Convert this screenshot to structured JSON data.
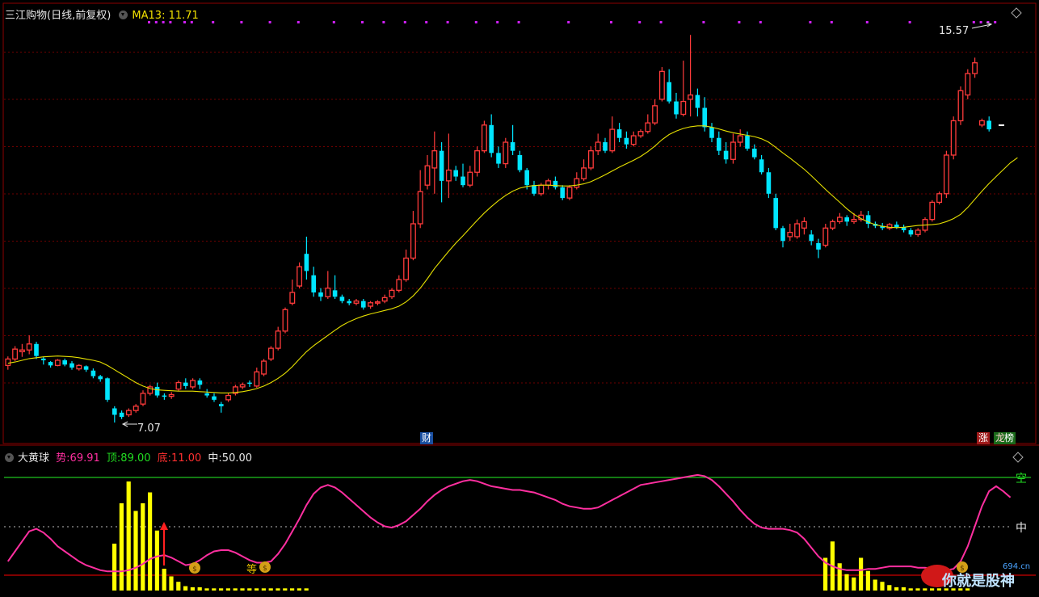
{
  "main_panel": {
    "stock_title": "三江购物(日线,前复权)",
    "ma_label": "MA13:",
    "ma_value": "11.71",
    "high_label": "15.57",
    "low_label": "7.07",
    "badge_cai": "财",
    "badge_zhang": "涨",
    "badge_long": "龙",
    "badge_bang": "榜"
  },
  "sub_panel": {
    "indicator_name": "大黄球",
    "shi_label": "势:",
    "shi_value": "69.91",
    "ding_label": "顶:",
    "ding_value": "89.00",
    "di_label": "底:",
    "di_value": "11.00",
    "zhong_label": "中:",
    "zhong_value": "50.00",
    "right_label_top": "空",
    "right_label_mid": "中",
    "deng_label": "等"
  },
  "watermark": {
    "text": "你就是股神",
    "site": "694.cn"
  },
  "colors": {
    "up": "#ff3b3b",
    "down": "#00e5ff",
    "ma": "#e6e000",
    "grid": "#8b0000",
    "indicator_line": "#ff2fa0",
    "bars": "#ffff00"
  },
  "chart_data": {
    "type": "candlestick",
    "price_range": [
      6.6,
      16.8
    ],
    "ma_period": 13,
    "candles": [
      [
        8.4,
        8.55,
        8.3,
        8.61
      ],
      [
        8.55,
        8.78,
        8.5,
        8.85
      ],
      [
        8.72,
        8.76,
        8.6,
        8.9
      ],
      [
        8.76,
        8.9,
        8.66,
        9.1
      ],
      [
        8.9,
        8.62,
        8.55,
        8.95
      ],
      [
        8.56,
        8.52,
        8.42,
        8.6
      ],
      [
        8.48,
        8.4,
        8.35,
        8.5
      ],
      [
        8.4,
        8.52,
        8.38,
        8.55
      ],
      [
        8.52,
        8.42,
        8.38,
        8.56
      ],
      [
        8.45,
        8.35,
        8.3,
        8.5
      ],
      [
        8.32,
        8.4,
        8.28,
        8.43
      ],
      [
        8.38,
        8.3,
        8.25,
        8.4
      ],
      [
        8.28,
        8.15,
        8.1,
        8.33
      ],
      [
        8.15,
        8.08,
        8.02,
        8.18
      ],
      [
        8.1,
        7.6,
        7.55,
        8.12
      ],
      [
        7.4,
        7.25,
        7.07,
        7.45
      ],
      [
        7.3,
        7.2,
        7.15,
        7.35
      ],
      [
        7.25,
        7.35,
        7.2,
        7.4
      ],
      [
        7.35,
        7.45,
        7.3,
        7.5
      ],
      [
        7.5,
        7.75,
        7.45,
        7.82
      ],
      [
        7.75,
        7.9,
        7.7,
        7.95
      ],
      [
        7.9,
        7.7,
        7.65,
        8.0
      ],
      [
        7.7,
        7.68,
        7.6,
        7.75
      ],
      [
        7.68,
        7.72,
        7.62,
        7.78
      ],
      [
        7.85,
        8.0,
        7.8,
        8.05
      ],
      [
        8.0,
        7.92,
        7.85,
        8.1
      ],
      [
        7.9,
        8.05,
        7.85,
        8.1
      ],
      [
        8.05,
        7.95,
        7.85,
        8.1
      ],
      [
        7.75,
        7.7,
        7.65,
        7.85
      ],
      [
        7.68,
        7.6,
        7.55,
        7.75
      ],
      [
        7.5,
        7.45,
        7.3,
        7.55
      ],
      [
        7.6,
        7.7,
        7.55,
        7.75
      ],
      [
        7.75,
        7.9,
        7.7,
        7.95
      ],
      [
        7.9,
        7.95,
        7.85,
        8.0
      ],
      [
        8.0,
        7.98,
        7.9,
        8.05
      ],
      [
        7.92,
        8.25,
        7.88,
        8.35
      ],
      [
        8.2,
        8.5,
        8.15,
        8.55
      ],
      [
        8.55,
        8.8,
        8.5,
        8.85
      ],
      [
        8.8,
        9.2,
        8.75,
        9.3
      ],
      [
        9.2,
        9.7,
        9.15,
        9.75
      ],
      [
        9.85,
        10.1,
        9.8,
        10.4
      ],
      [
        10.25,
        10.7,
        10.2,
        10.8
      ],
      [
        11.0,
        10.6,
        10.4,
        11.4
      ],
      [
        10.5,
        10.1,
        10.0,
        10.7
      ],
      [
        10.1,
        10.0,
        9.9,
        10.2
      ],
      [
        10.0,
        10.2,
        9.95,
        10.6
      ],
      [
        10.15,
        10.0,
        9.95,
        10.5
      ],
      [
        10.0,
        9.9,
        9.85,
        10.05
      ],
      [
        9.9,
        9.85,
        9.8,
        9.95
      ],
      [
        9.85,
        9.9,
        9.8,
        9.95
      ],
      [
        9.9,
        9.75,
        9.7,
        9.95
      ],
      [
        9.78,
        9.86,
        9.72,
        9.9
      ],
      [
        9.86,
        9.88,
        9.8,
        9.92
      ],
      [
        9.9,
        9.98,
        9.85,
        10.05
      ],
      [
        10.0,
        10.15,
        9.95,
        10.2
      ],
      [
        10.15,
        10.4,
        10.1,
        10.5
      ],
      [
        10.4,
        10.9,
        10.35,
        11.1
      ],
      [
        10.9,
        11.7,
        10.85,
        12.0
      ],
      [
        11.7,
        12.45,
        11.6,
        12.95
      ],
      [
        12.6,
        13.05,
        12.5,
        13.3
      ],
      [
        13.0,
        13.4,
        12.4,
        13.85
      ],
      [
        13.4,
        12.7,
        12.2,
        13.6
      ],
      [
        12.7,
        12.95,
        12.3,
        13.8
      ],
      [
        12.95,
        12.8,
        12.7,
        13.05
      ],
      [
        12.8,
        12.6,
        12.55,
        13.1
      ],
      [
        12.6,
        12.9,
        12.55,
        13.05
      ],
      [
        12.9,
        13.4,
        12.8,
        13.5
      ],
      [
        13.4,
        14.0,
        13.35,
        14.1
      ],
      [
        14.0,
        13.35,
        13.25,
        14.25
      ],
      [
        13.35,
        13.1,
        13.0,
        13.5
      ],
      [
        13.1,
        13.6,
        13.0,
        13.7
      ],
      [
        13.6,
        13.4,
        13.3,
        14.0
      ],
      [
        13.3,
        12.95,
        12.9,
        13.4
      ],
      [
        12.95,
        12.6,
        12.5,
        13.0
      ],
      [
        12.6,
        12.4,
        12.35,
        12.7
      ],
      [
        12.4,
        12.6,
        12.35,
        12.65
      ],
      [
        12.6,
        12.7,
        12.5,
        12.75
      ],
      [
        12.7,
        12.55,
        12.5,
        12.8
      ],
      [
        12.55,
        12.3,
        12.25,
        12.6
      ],
      [
        12.3,
        12.55,
        12.25,
        12.6
      ],
      [
        12.55,
        12.75,
        12.5,
        12.9
      ],
      [
        12.75,
        13.0,
        12.7,
        13.2
      ],
      [
        13.0,
        13.4,
        12.95,
        13.5
      ],
      [
        13.4,
        13.6,
        13.3,
        13.8
      ],
      [
        13.6,
        13.4,
        13.35,
        13.7
      ],
      [
        13.4,
        13.9,
        13.35,
        14.2
      ],
      [
        13.9,
        13.7,
        13.6,
        14.05
      ],
      [
        13.7,
        13.55,
        13.45,
        13.85
      ],
      [
        13.55,
        13.75,
        13.5,
        13.85
      ],
      [
        13.75,
        13.85,
        13.7,
        13.9
      ],
      [
        13.85,
        14.05,
        13.8,
        14.25
      ],
      [
        14.05,
        14.45,
        14.0,
        14.6
      ],
      [
        14.6,
        15.25,
        14.55,
        15.35
      ],
      [
        15.0,
        14.55,
        14.5,
        15.3
      ],
      [
        14.55,
        14.25,
        14.15,
        14.75
      ],
      [
        14.25,
        14.55,
        14.2,
        15.5
      ],
      [
        14.6,
        14.7,
        14.2,
        16.1
      ],
      [
        14.7,
        14.4,
        14.2,
        14.85
      ],
      [
        14.4,
        13.95,
        13.85,
        14.65
      ],
      [
        13.95,
        13.7,
        13.6,
        14.05
      ],
      [
        13.7,
        13.4,
        13.3,
        13.85
      ],
      [
        13.4,
        13.2,
        13.1,
        13.6
      ],
      [
        13.2,
        13.6,
        13.1,
        13.8
      ],
      [
        13.6,
        13.75,
        13.5,
        13.9
      ],
      [
        13.75,
        13.45,
        13.4,
        13.85
      ],
      [
        13.45,
        13.25,
        13.2,
        13.55
      ],
      [
        13.2,
        12.9,
        12.85,
        13.3
      ],
      [
        12.9,
        12.4,
        12.3,
        13.0
      ],
      [
        12.3,
        11.6,
        11.55,
        12.4
      ],
      [
        11.6,
        11.3,
        11.15,
        11.65
      ],
      [
        11.4,
        11.5,
        11.3,
        11.7
      ],
      [
        11.4,
        11.7,
        11.35,
        11.8
      ],
      [
        11.6,
        11.75,
        11.45,
        11.85
      ],
      [
        11.45,
        11.3,
        11.2,
        11.55
      ],
      [
        11.25,
        11.1,
        10.9,
        11.35
      ],
      [
        11.2,
        11.6,
        11.15,
        11.7
      ],
      [
        11.6,
        11.75,
        11.55,
        11.8
      ],
      [
        11.75,
        11.85,
        11.7,
        11.95
      ],
      [
        11.85,
        11.75,
        11.65,
        11.9
      ],
      [
        11.75,
        11.8,
        11.7,
        11.95
      ],
      [
        11.8,
        11.9,
        11.75,
        12.0
      ],
      [
        11.9,
        11.7,
        11.6,
        12.0
      ],
      [
        11.7,
        11.65,
        11.6,
        11.75
      ],
      [
        11.65,
        11.6,
        11.55,
        11.72
      ],
      [
        11.6,
        11.68,
        11.55,
        11.72
      ],
      [
        11.68,
        11.62,
        11.58,
        11.75
      ],
      [
        11.62,
        11.55,
        11.5,
        11.68
      ],
      [
        11.55,
        11.45,
        11.4,
        11.6
      ],
      [
        11.45,
        11.55,
        11.4,
        11.6
      ],
      [
        11.55,
        11.8,
        11.5,
        11.85
      ],
      [
        11.8,
        12.2,
        11.75,
        12.25
      ],
      [
        12.2,
        12.4,
        12.15,
        12.45
      ],
      [
        12.4,
        13.3,
        12.3,
        13.4
      ],
      [
        13.3,
        14.1,
        13.2,
        14.2
      ],
      [
        14.1,
        14.8,
        14.0,
        14.9
      ],
      [
        14.7,
        15.2,
        14.6,
        15.3
      ],
      [
        15.2,
        15.45,
        15.1,
        15.57
      ],
      [
        14.0,
        14.1,
        13.95,
        14.15
      ],
      [
        14.1,
        13.9,
        13.85,
        14.2
      ]
    ],
    "ma_values": [
      8.45,
      8.48,
      8.52,
      8.56,
      8.58,
      8.6,
      8.61,
      8.62,
      8.61,
      8.6,
      8.58,
      8.55,
      8.52,
      8.48,
      8.4,
      8.3,
      8.2,
      8.1,
      8.0,
      7.92,
      7.86,
      7.83,
      7.82,
      7.81,
      7.8,
      7.8,
      7.8,
      7.79,
      7.78,
      7.77,
      7.76,
      7.76,
      7.77,
      7.79,
      7.82,
      7.86,
      7.92,
      8.0,
      8.1,
      8.22,
      8.37,
      8.55,
      8.72,
      8.86,
      8.98,
      9.1,
      9.22,
      9.33,
      9.42,
      9.49,
      9.55,
      9.6,
      9.64,
      9.68,
      9.72,
      9.78,
      9.88,
      10.02,
      10.2,
      10.42,
      10.66,
      10.86,
      11.06,
      11.25,
      11.42,
      11.6,
      11.78,
      11.95,
      12.1,
      12.24,
      12.36,
      12.46,
      12.53,
      12.57,
      12.59,
      12.6,
      12.6,
      12.59,
      12.58,
      12.58,
      12.6,
      12.63,
      12.68,
      12.76,
      12.84,
      12.93,
      13.02,
      13.1,
      13.18,
      13.27,
      13.38,
      13.51,
      13.66,
      13.78,
      13.86,
      13.92,
      13.96,
      13.98,
      13.98,
      13.95,
      13.91,
      13.86,
      13.82,
      13.79,
      13.76,
      13.73,
      13.68,
      13.6,
      13.48,
      13.35,
      13.23,
      13.1,
      12.97,
      12.82,
      12.66,
      12.5,
      12.35,
      12.2,
      12.05,
      11.92,
      11.82,
      11.74,
      11.68,
      11.64,
      11.62,
      11.61,
      11.62,
      11.64,
      11.66,
      11.67,
      11.68,
      11.7,
      11.75,
      11.82,
      11.92,
      12.08,
      12.27,
      12.46,
      12.64,
      12.8,
      12.96,
      13.12,
      13.24
    ],
    "indicator": {
      "range": [
        0,
        100
      ],
      "levels": {
        "ding": 89.0,
        "zhong": 50.0,
        "di": 11.0
      },
      "shi_series": [
        22,
        30,
        38,
        46,
        48,
        45,
        40,
        34,
        30,
        26,
        22,
        19,
        17,
        15,
        14,
        14,
        14,
        15,
        17,
        20,
        24,
        26,
        27,
        25,
        22,
        19,
        20,
        23,
        27,
        30,
        31,
        31,
        29,
        26,
        23,
        21,
        21,
        22,
        28,
        36,
        46,
        56,
        67,
        76,
        81,
        83,
        81,
        77,
        72,
        67,
        62,
        57,
        53,
        50,
        49,
        51,
        54,
        59,
        64,
        70,
        75,
        79,
        82,
        84,
        86,
        87,
        86,
        84,
        82,
        81,
        80,
        79,
        79,
        78,
        77,
        75,
        73,
        71,
        68,
        66,
        65,
        64,
        64,
        65,
        68,
        71,
        74,
        77,
        80,
        83,
        84,
        85,
        86,
        87,
        88,
        89,
        90,
        91,
        90,
        87,
        82,
        76,
        70,
        63,
        57,
        52,
        49,
        48,
        48,
        48,
        47,
        45,
        40,
        33,
        26,
        21,
        18,
        16,
        15,
        15,
        15,
        16,
        16,
        17,
        18,
        18,
        18,
        18,
        17,
        17,
        16,
        15,
        15,
        16,
        22,
        34,
        50,
        66,
        78,
        82,
        78,
        73
      ],
      "yellow_bars": [
        [
          15,
          43
        ],
        [
          16,
          80
        ],
        [
          17,
          100
        ],
        [
          18,
          73
        ],
        [
          19,
          80
        ],
        [
          20,
          90
        ],
        [
          21,
          55
        ],
        [
          22,
          20
        ],
        [
          23,
          13
        ],
        [
          24,
          8
        ],
        [
          25,
          4
        ],
        [
          26,
          3
        ],
        [
          27,
          3
        ],
        [
          28,
          2
        ],
        [
          29,
          2
        ],
        [
          30,
          2
        ],
        [
          31,
          2
        ],
        [
          32,
          2
        ],
        [
          33,
          2
        ],
        [
          34,
          2
        ],
        [
          35,
          2
        ],
        [
          36,
          2
        ],
        [
          37,
          2
        ],
        [
          38,
          2
        ],
        [
          39,
          2
        ],
        [
          40,
          2
        ],
        [
          41,
          2
        ],
        [
          42,
          2
        ],
        [
          115,
          30
        ],
        [
          116,
          45
        ],
        [
          117,
          25
        ],
        [
          118,
          15
        ],
        [
          119,
          12
        ],
        [
          120,
          30
        ],
        [
          121,
          18
        ],
        [
          122,
          10
        ],
        [
          123,
          8
        ],
        [
          124,
          5
        ],
        [
          125,
          3
        ],
        [
          126,
          3
        ],
        [
          127,
          2
        ],
        [
          128,
          2
        ],
        [
          129,
          2
        ],
        [
          130,
          2
        ],
        [
          131,
          2
        ],
        [
          132,
          2
        ],
        [
          133,
          2
        ],
        [
          134,
          2
        ],
        [
          135,
          2
        ]
      ]
    }
  }
}
